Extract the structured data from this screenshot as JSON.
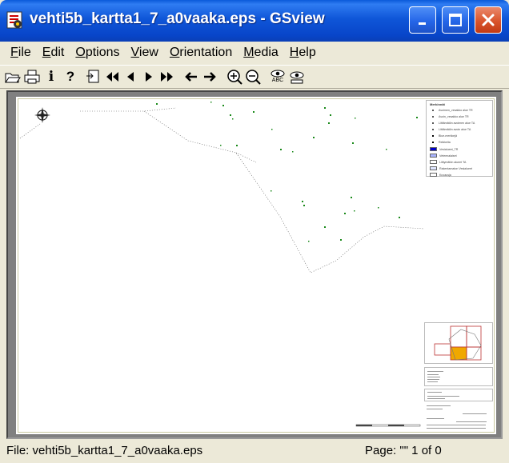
{
  "window": {
    "title": "vehti5b_kartta1_7_a0vaaka.eps - GSview",
    "minimize_icon": "minimize-icon",
    "maximize_icon": "maximize-icon",
    "close_icon": "close-icon"
  },
  "menu": {
    "items": [
      {
        "label": "File",
        "accel": "F",
        "rest": "ile"
      },
      {
        "label": "Edit",
        "accel": "E",
        "rest": "dit"
      },
      {
        "label": "Options",
        "accel": "O",
        "rest": "ptions"
      },
      {
        "label": "View",
        "accel": "V",
        "rest": "iew"
      },
      {
        "label": "Orientation",
        "accel": "O",
        "rest": "rientation"
      },
      {
        "label": "Media",
        "accel": "M",
        "rest": "edia"
      },
      {
        "label": "Help",
        "accel": "H",
        "rest": "elp"
      }
    ]
  },
  "toolbar": {
    "buttons": [
      {
        "name": "open-icon"
      },
      {
        "name": "print-icon"
      },
      {
        "name": "info-icon",
        "glyph": "i"
      },
      {
        "name": "help-icon",
        "glyph": "?"
      },
      {
        "name": "goto-page-icon"
      },
      {
        "name": "first-page-icon"
      },
      {
        "name": "previous-page-icon"
      },
      {
        "name": "next-page-icon"
      },
      {
        "name": "last-page-icon"
      },
      {
        "name": "back-icon"
      },
      {
        "name": "forward-icon"
      },
      {
        "name": "zoom-in-icon"
      },
      {
        "name": "zoom-out-icon"
      },
      {
        "name": "text-extract-icon",
        "glyph": "ABC"
      },
      {
        "name": "view-icon"
      }
    ]
  },
  "legend": {
    "title": "Merkinnät",
    "rows": [
      "Avoimen_vesakko alue TR",
      "Avoin_vesakko alue TR",
      "Liittämätön avoimen alue TA",
      "Liittämätön avoin alue TA",
      "Blue-merkkejä",
      "Reikkeita",
      "Vesialueet_TR",
      "Veteenalaiset",
      "Liittymätön alueet TA",
      "Rakentamaton Vesialueet",
      "Kuvausja"
    ]
  },
  "status": {
    "file": "File: vehti5b_kartta1_7_a0vaaka.eps",
    "page": "Page: \"\"  1 of 0"
  },
  "colors": {
    "title_blue": "#0a5ad9",
    "close_red": "#d9542c",
    "map_points": "#1a8a1a",
    "overview_highlight": "#f0a800"
  }
}
